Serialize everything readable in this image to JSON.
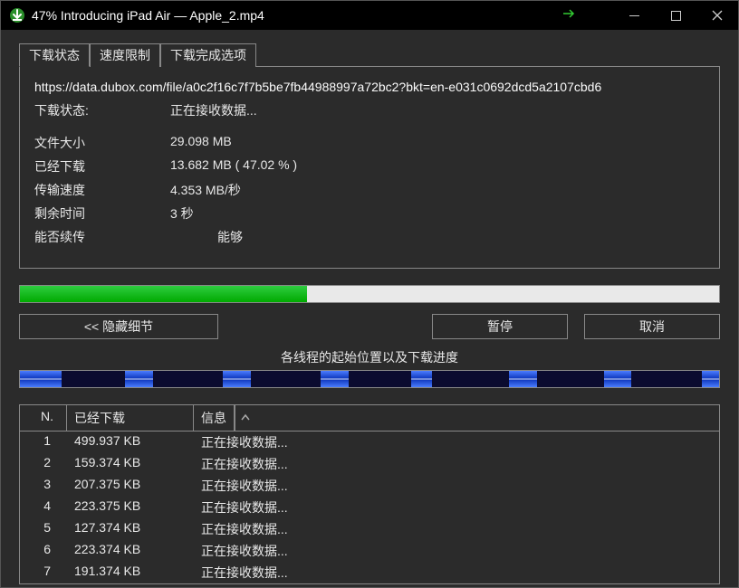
{
  "titlebar": {
    "title": "47% Introducing iPad Air — Apple_2.mp4"
  },
  "tabs": {
    "status": "下载状态",
    "speedlimit": "速度限制",
    "oncomplete": "下载完成选项"
  },
  "panel": {
    "url": "https://data.dubox.com/file/a0c2f16c7f7b5be7fb44988997a72bc2?bkt=en-e031c0692dcd5a2107cbd6",
    "status_label": "下载状态:",
    "status_value": "正在接收数据...",
    "filesize_label": "文件大小",
    "filesize_value": "29.098  MB",
    "downloaded_label": "已经下载",
    "downloaded_value": "13.682  MB  ( 47.02 % )",
    "speed_label": "传输速度",
    "speed_value": "4.353  MB/秒",
    "timeleft_label": "剩余时间",
    "timeleft_value": "3 秒",
    "resume_label": "能否续传",
    "resume_value": "能够"
  },
  "progress_percent": 41,
  "buttons": {
    "hide": "<<  隐藏细节",
    "pause": "暂停",
    "cancel": "取消"
  },
  "threads_label": "各线程的起始位置以及下载进度",
  "table": {
    "headers": {
      "n": "N.",
      "dl": "已经下载",
      "info": "信息"
    },
    "rows": [
      {
        "n": "1",
        "dl": "499.937  KB",
        "info": "正在接收数据..."
      },
      {
        "n": "2",
        "dl": "159.374  KB",
        "info": "正在接收数据..."
      },
      {
        "n": "3",
        "dl": "207.375  KB",
        "info": "正在接收数据..."
      },
      {
        "n": "4",
        "dl": "223.375  KB",
        "info": "正在接收数据..."
      },
      {
        "n": "5",
        "dl": "127.374  KB",
        "info": "正在接收数据..."
      },
      {
        "n": "6",
        "dl": "223.374  KB",
        "info": "正在接收数据..."
      },
      {
        "n": "7",
        "dl": "191.374  KB",
        "info": "正在接收数据..."
      }
    ]
  }
}
